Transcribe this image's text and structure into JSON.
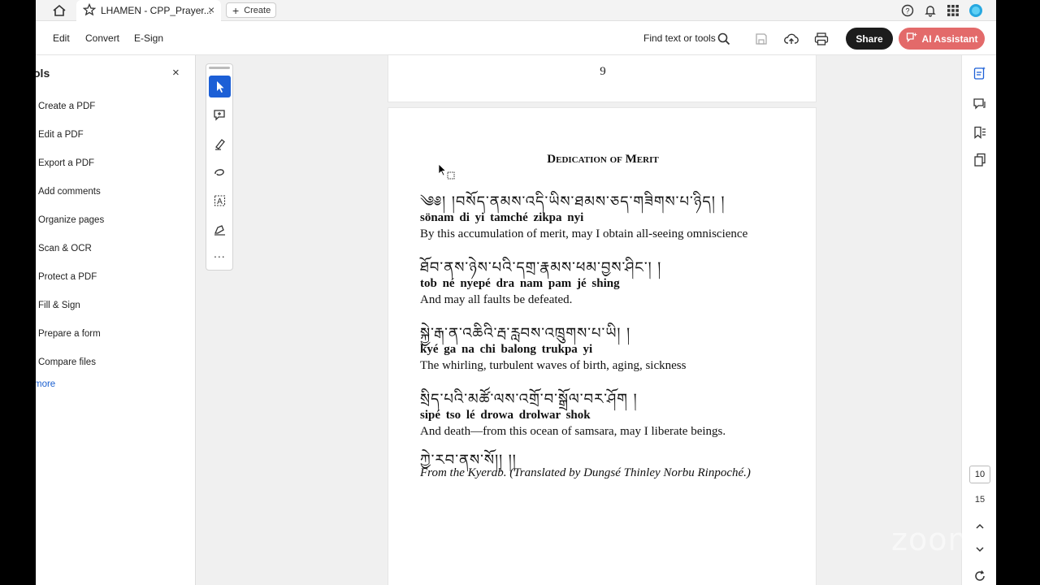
{
  "browser": {
    "tab_title": "LHAMEN - CPP_Prayer...",
    "tab_close": "×",
    "create_label": "Create"
  },
  "toolbar": {
    "menu": [
      "Edit",
      "Convert",
      "E-Sign"
    ],
    "find_label": "Find text or tools",
    "share_label": "Share",
    "ai_label": "AI Assistant"
  },
  "tools_panel": {
    "title": "ols",
    "close": "×",
    "items": [
      "Create a PDF",
      "Edit a PDF",
      "Export a PDF",
      "Add comments",
      "Organize pages",
      "Scan & OCR",
      "Protect a PDF",
      "Fill & Sign",
      "Prepare a form",
      "Compare files"
    ],
    "more": "more"
  },
  "quick_tools": {
    "more": "..."
  },
  "document": {
    "page_number": "9",
    "heading": "Dedication of Merit",
    "verses": [
      {
        "tibetan": "༄༅། །བསོད་ནམས་འདི་ཡིས་ཐམས་ཅད་གཟིགས་པ་ཉིད། །",
        "translit": "sönam   di yi   tamché   zikpa nyi",
        "translation": "By this accumulation of merit, may I obtain all-seeing omniscience"
      },
      {
        "tibetan": "ཐོབ་ནས་ཉེས་པའི་དགྲ་རྣམས་ཕམ་བྱས་ཤིང་། །",
        "translit": "tob né   nyepé   dra nam   pam jé shing",
        "translation": "And may all faults be defeated."
      },
      {
        "tibetan": "སྐྱེ་རྒ་ན་འཆིའི་རྦ་རླབས་འཁྲུགས་པ་ཡི། །",
        "translit": "kyé ga   na chi   balong   trukpa yi",
        "translation": "The whirling, turbulent waves of birth, aging, sickness"
      },
      {
        "tibetan": "སྲིད་པའི་མཚོ་ལས་འགྲོ་བ་སྒྲོལ་བར་ཤོག །",
        "translit": "sipé   tso lé   drowa   drolwar shok",
        "translation": "And death—from this ocean of samsara, may I liberate beings."
      }
    ],
    "closing_tibetan": "ཀྱེ་རབ་ནས་སོ།། །།",
    "citation": "From the Kyerab. (Translated by Dungsé Thinley Norbu Rinpoché.)"
  },
  "pager": {
    "current": "10",
    "total": "15"
  },
  "watermark": "zoom"
}
